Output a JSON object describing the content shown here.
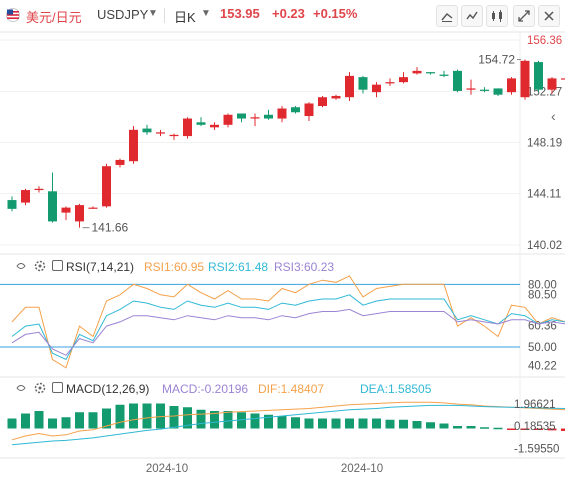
{
  "header": {
    "pair_name": "美元/日元",
    "symbol": "USDJPY",
    "period": "日K",
    "price": "153.95",
    "change": "+0.23",
    "change_pct": "+0.15%"
  },
  "toolbar": {
    "icons": [
      "line-draw-icon",
      "indicator-icon",
      "candle-settings-icon",
      "fullscreen-icon",
      "close-icon"
    ]
  },
  "rsi": {
    "label": "RSI(7,14,21)",
    "rsi1": "RSI1:60.95",
    "rsi2": "RSI2:61.48",
    "rsi3": "RSI3:60.23"
  },
  "macd": {
    "label": "MACD(12,26,9)",
    "macd": "MACD:-0.20196",
    "dif": "DIF:1.48407",
    "dea": "DEA:1.58505"
  },
  "colors": {
    "up": "#e0292f",
    "down": "#139a6f",
    "rsi1": "#f5a14a",
    "rsi2": "#30b8d6",
    "rsi3": "#9b84d4",
    "dif": "#f5a14a",
    "dea": "#30b8d6",
    "level_line": "#3aa0e0",
    "label_red": "#e0454a"
  },
  "chart_data": {
    "type": "candlestick",
    "price_axis": {
      "ticks": [
        "156.36",
        "152.27",
        "148.19",
        "144.11",
        "140.02"
      ],
      "min": 140.02,
      "max": 156.36
    },
    "annotations": {
      "high_label": "154.72",
      "low_label": "141.66"
    },
    "x_ticks": [
      "2024-10",
      "2024-10"
    ],
    "candles": [
      [
        143.6,
        143.9,
        142.7,
        142.9
      ],
      [
        143.4,
        144.5,
        143.2,
        144.4
      ],
      [
        144.4,
        144.7,
        144.2,
        144.5
      ],
      [
        144.3,
        145.8,
        141.8,
        141.9
      ],
      [
        142.6,
        143.1,
        142.0,
        143.0
      ],
      [
        141.9,
        143.3,
        141.4,
        143.2
      ],
      [
        143.0,
        143.1,
        142.9,
        143.0
      ],
      [
        143.1,
        146.5,
        143.0,
        146.3
      ],
      [
        146.4,
        146.9,
        146.2,
        146.8
      ],
      [
        146.7,
        149.5,
        146.5,
        149.2
      ],
      [
        149.3,
        149.6,
        148.8,
        149.0
      ],
      [
        148.9,
        149.2,
        148.7,
        149.0
      ],
      [
        148.7,
        148.9,
        148.4,
        148.8
      ],
      [
        148.7,
        150.2,
        148.5,
        150.1
      ],
      [
        149.8,
        150.2,
        149.5,
        149.6
      ],
      [
        149.4,
        149.8,
        149.2,
        149.6
      ],
      [
        149.6,
        150.5,
        149.4,
        150.4
      ],
      [
        150.5,
        150.5,
        149.8,
        150.1
      ],
      [
        150.1,
        150.5,
        149.5,
        150.2
      ],
      [
        150.4,
        150.8,
        150.0,
        150.1
      ],
      [
        150.1,
        151.1,
        149.8,
        150.9
      ],
      [
        151.0,
        151.1,
        150.5,
        150.6
      ],
      [
        150.3,
        151.4,
        149.9,
        151.3
      ],
      [
        151.1,
        151.9,
        151.0,
        151.8
      ],
      [
        151.7,
        152.0,
        151.6,
        151.9
      ],
      [
        151.8,
        153.8,
        151.5,
        153.5
      ],
      [
        153.4,
        153.5,
        152.1,
        152.4
      ],
      [
        152.2,
        153.0,
        151.8,
        152.8
      ],
      [
        152.9,
        153.3,
        152.7,
        153.0
      ],
      [
        153.0,
        153.8,
        152.9,
        153.4
      ],
      [
        153.7,
        154.2,
        153.6,
        153.9
      ],
      [
        153.8,
        153.8,
        153.6,
        153.7
      ],
      [
        153.6,
        153.9,
        153.4,
        153.5
      ],
      [
        153.9,
        154.0,
        152.2,
        152.3
      ],
      [
        152.4,
        153.2,
        152.0,
        152.5
      ],
      [
        152.4,
        152.6,
        152.2,
        152.3
      ],
      [
        152.5,
        152.5,
        151.9,
        152.0
      ],
      [
        152.2,
        153.4,
        152.0,
        153.3
      ],
      [
        151.8,
        154.8,
        151.6,
        154.7
      ],
      [
        154.6,
        154.7,
        152.2,
        152.4
      ],
      [
        152.4,
        153.4,
        152.1,
        153.3
      ],
      [
        153.3,
        153.6,
        152.8,
        153.3
      ],
      [
        152.8,
        153.9,
        152.7,
        153.8
      ],
      [
        153.5,
        154.1,
        153.4,
        153.95
      ]
    ],
    "rsi_axis": {
      "ticks": [
        "80.00",
        "80.50",
        "60.36",
        "50.00",
        "40.22"
      ],
      "levels": [
        80,
        50
      ],
      "min": 38,
      "max": 84
    },
    "rsi1": [
      62,
      69,
      69,
      44,
      40,
      60,
      55,
      72,
      75,
      80,
      78,
      75,
      74,
      80,
      76,
      73,
      77,
      73,
      73,
      72,
      78,
      76,
      80,
      82,
      81,
      84,
      74,
      78,
      79,
      80,
      80,
      80,
      80,
      60,
      64,
      60,
      55,
      70,
      69,
      61,
      64,
      62,
      63,
      62
    ],
    "rsi2": [
      55,
      60,
      61,
      47,
      44,
      56,
      53,
      65,
      68,
      72,
      71,
      69,
      68,
      72,
      70,
      69,
      71,
      69,
      69,
      68,
      71,
      70,
      72,
      73,
      73,
      75,
      70,
      72,
      73,
      73,
      73,
      73,
      73,
      63,
      65,
      63,
      61,
      66,
      65,
      61,
      63,
      62,
      63,
      62
    ],
    "rsi3": [
      52,
      56,
      57,
      49,
      46,
      54,
      52,
      60,
      62,
      65,
      65,
      64,
      63,
      65,
      64,
      63,
      65,
      64,
      64,
      63,
      65,
      64,
      66,
      67,
      67,
      68,
      65,
      66,
      67,
      67,
      67,
      67,
      67,
      62,
      63,
      62,
      61,
      63,
      63,
      61,
      62,
      61,
      62,
      61
    ],
    "macd_axis": {
      "ticks": [
        "1.96621",
        "0.18535",
        "-1.59550"
      ],
      "min": -2.2,
      "max": 2.6
    },
    "dif": [
      -0.9,
      -0.6,
      -0.4,
      -0.6,
      -0.5,
      -0.2,
      -0.1,
      0.2,
      0.5,
      0.7,
      0.85,
      0.95,
      1.0,
      1.1,
      1.15,
      1.2,
      1.3,
      1.35,
      1.4,
      1.45,
      1.5,
      1.55,
      1.6,
      1.7,
      1.8,
      1.9,
      1.95,
      2.0,
      2.05,
      2.1,
      2.1,
      2.1,
      2.05,
      1.95,
      1.9,
      1.8,
      1.75,
      1.7,
      1.65,
      1.6,
      1.55,
      1.5,
      1.5,
      1.48
    ],
    "dea": [
      -1.3,
      -1.2,
      -1.1,
      -1.0,
      -0.95,
      -0.85,
      -0.75,
      -0.6,
      -0.45,
      -0.3,
      -0.15,
      -0.05,
      0.1,
      0.25,
      0.4,
      0.5,
      0.6,
      0.7,
      0.8,
      0.9,
      1.0,
      1.1,
      1.2,
      1.3,
      1.4,
      1.5,
      1.55,
      1.6,
      1.7,
      1.75,
      1.8,
      1.85,
      1.85,
      1.85,
      1.8,
      1.75,
      1.72,
      1.7,
      1.68,
      1.65,
      1.62,
      1.6,
      1.59,
      1.585
    ],
    "macd_hist": [
      0.8,
      1.2,
      1.4,
      0.8,
      0.9,
      1.3,
      1.3,
      1.6,
      1.9,
      2.0,
      2.0,
      2.0,
      1.8,
      1.7,
      1.5,
      1.4,
      1.4,
      1.3,
      1.2,
      1.1,
      1.0,
      0.9,
      0.8,
      0.8,
      0.8,
      0.8,
      0.8,
      0.8,
      0.7,
      0.7,
      0.6,
      0.5,
      0.4,
      0.2,
      0.2,
      0.1,
      0.06,
      -0.05,
      -0.1,
      -0.1,
      -0.15,
      -0.2,
      -0.2,
      -0.2
    ]
  }
}
